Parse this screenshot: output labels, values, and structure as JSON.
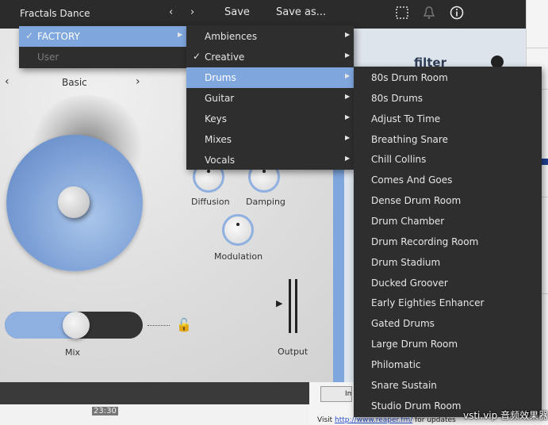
{
  "topbar": {
    "preset_name": "Fractals Dance",
    "prev": "‹",
    "next": "›",
    "save": "Save",
    "save_as": "Save as..."
  },
  "plugin": {
    "mode_prev": "‹",
    "mode_next": "›",
    "mode_label": "Basic",
    "filter_label": "filter",
    "knobs": {
      "diffusion": "Diffusion",
      "damping": "Damping",
      "modulation": "Modulation"
    },
    "mix_label": "Mix",
    "output_label": "Output",
    "mix_level": 0.52,
    "accent_color": "#7fa6dd"
  },
  "menu_level1": [
    {
      "label": "FACTORY",
      "checked": true,
      "selected": true,
      "submenu": true
    },
    {
      "label": "User",
      "checked": false,
      "selected": false,
      "disabled": true,
      "submenu": false
    }
  ],
  "menu_level2": [
    {
      "label": "Ambiences",
      "checked": false,
      "submenu": true
    },
    {
      "label": "Creative",
      "checked": true,
      "submenu": true
    },
    {
      "label": "Drums",
      "checked": false,
      "selected": true,
      "submenu": true
    },
    {
      "label": "Guitar",
      "checked": false,
      "submenu": true
    },
    {
      "label": "Keys",
      "checked": false,
      "submenu": true
    },
    {
      "label": "Mixes",
      "checked": false,
      "submenu": true
    },
    {
      "label": "Vocals",
      "checked": false,
      "submenu": true
    }
  ],
  "menu_level3": [
    "80s Drum Room",
    "80s Drums",
    "Adjust To Time",
    "Breathing Snare",
    "Chill Collins",
    "Comes And Goes",
    "Dense Drum Room",
    "Drum Chamber",
    "Drum Recording Room",
    "Drum Stadium",
    "Ducked Groover",
    "Early Eighties Enhancer",
    "Gated Drums",
    "Large Drum Room",
    "Philomatic",
    "Snare Sustain",
    "Studio Drum Room"
  ],
  "background": {
    "timecode": "23:30",
    "button_label": "Im",
    "visit_prefix": "Visit ",
    "visit_link": "http://www.reaper.fm/",
    "visit_suffix": " for updates",
    "watermark": "vsti.vip 音频效果器"
  },
  "glyphs": {
    "check": "✓",
    "submenu": "▶",
    "lock": "🔓",
    "play": "▶"
  }
}
